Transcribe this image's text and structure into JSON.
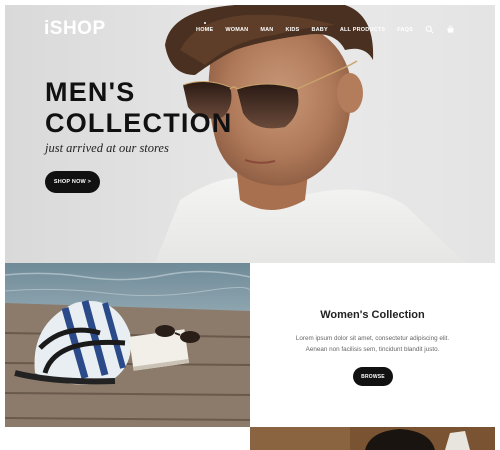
{
  "brand": {
    "logo": "iSHOP"
  },
  "nav": {
    "items": [
      "HOME",
      "WOMAN",
      "MAN",
      "KIDS",
      "BABY",
      "ALL PRODUCTS",
      "FAQS"
    ],
    "icons": [
      "search-icon",
      "cart-icon"
    ]
  },
  "hero": {
    "title_line1": "MEN'S",
    "title_line2": "COLLECTION",
    "subtitle": "just arrived at our stores",
    "button": "SHOP NOW >"
  },
  "women": {
    "title": "Women's Collection",
    "text_line1": "Lorem ipsum dolor sit amet, consectetur adipiscing elit.",
    "text_line2": "Aenean non facilisis sem, tincidunt blandit justo.",
    "button": "BROWSE"
  },
  "colors": {
    "dark": "#111111",
    "white": "#ffffff",
    "text_gray": "#666666"
  }
}
